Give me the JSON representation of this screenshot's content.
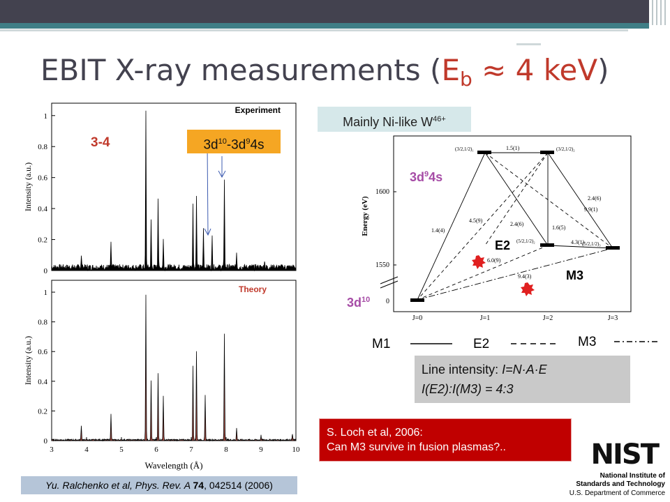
{
  "slide": {
    "title_pre": "EBIT X-ray measurements (",
    "title_eb": "E",
    "title_eb_sub": "b",
    "title_post": " ≈ 4 keV",
    "title_close": ")"
  },
  "left_figure": {
    "panel_top_label": "Experiment",
    "panel_bottom_label": "Theory",
    "ylabel_top": "Intensity (a.u.)",
    "ylabel_bottom": "Intensity (a.u.)",
    "xlabel": "Wavelength (Å)",
    "y_ticks_top": [
      "0",
      "0.2",
      "0.4",
      "0.6",
      "0.8",
      "1"
    ],
    "y_ticks_bottom": [
      "0",
      "0.2",
      "0.4",
      "0.6",
      "0.8",
      "1"
    ],
    "x_ticks": [
      "3",
      "4",
      "5",
      "6",
      "7",
      "8",
      "9",
      "10"
    ],
    "label_34": "3-4",
    "label_trans_a": "3d",
    "label_trans_a_sup": "10",
    "label_trans_b": "-3d",
    "label_trans_b_sup": "9",
    "label_trans_c": "4s"
  },
  "citation": {
    "pre": "Yu. Ralchenko et al, Phys. Rev. A ",
    "vol": "74",
    "post": ", 042514 (2006)"
  },
  "right_figure": {
    "box_text": "Mainly Ni-like W",
    "box_sup": "46+",
    "ylabel": "Energy (eV)",
    "y_ticks": [
      "1600",
      "1550",
      "0"
    ],
    "x_ticks": [
      "J=0",
      "J=1",
      "J=2",
      "J=3"
    ],
    "level_labels": [
      "(3/2,1/2)₁",
      "(3/2,1/2)₂",
      "(5/2,1/2)₂",
      "(5/2,1/2)₃"
    ],
    "transition_labels": [
      "1.5(1)",
      "2.4(6)",
      "9.9(1)",
      "4.5(9)",
      "2.4(6)",
      "1.6(5)",
      "4.3(1)",
      "1.4(4)",
      "6.0(9)",
      "9.4(3)"
    ],
    "label_3d94s_a": "3d",
    "label_3d94s_sup": "9",
    "label_3d94s_b": "4s",
    "label_3d10": "3d",
    "label_3d10_sup": "10",
    "label_E2": "E2",
    "label_M3": "M3"
  },
  "legend": {
    "m1": "M1",
    "e2": "E2",
    "m3": "M3"
  },
  "intensity_box": {
    "line1_a": "Line intensity: ",
    "line1_b": "I=N·A·E",
    "line2": "I(E2):I(M3) = 4:3"
  },
  "loch_box": {
    "line1": "S. Loch et al, 2006:",
    "line2": "Can M3 survive in fusion plasmas?.."
  },
  "nist": {
    "logo": "NIST",
    "line1": "National Institute of",
    "line2": "Standards and Technology",
    "line3": "U.S. Department of Commerce"
  },
  "colors": {
    "title": "#43424f",
    "accent": "#c0392b",
    "teal": "#3f7e86",
    "orange": "#f5a623",
    "magenta": "#a64ca6",
    "red_box": "#c00000",
    "grey_box": "#c9c9c9",
    "light_teal_box": "#d6e8ea"
  }
}
